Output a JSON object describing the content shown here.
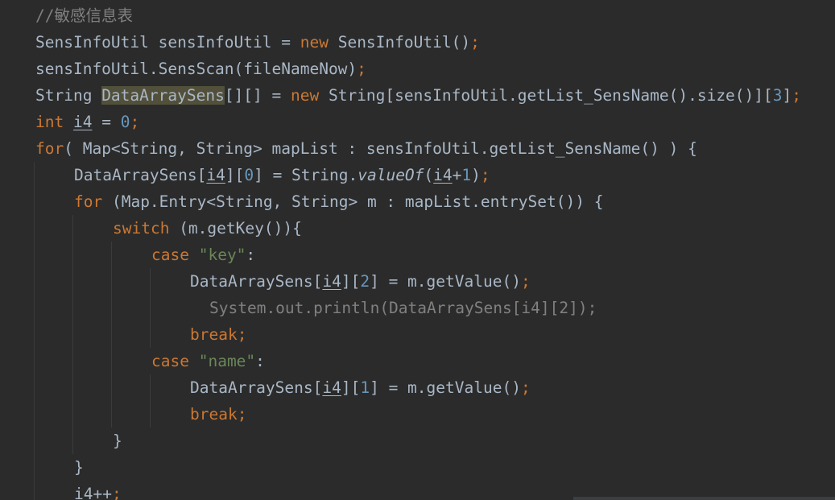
{
  "editor": {
    "language": "java",
    "colors": {
      "background": "#2b2b2b",
      "default_text": "#a9b7c6",
      "keyword": "#cc7832",
      "number": "#6897bb",
      "string": "#6a8759",
      "comment": "#808080",
      "highlight": "#52503a"
    },
    "lines": [
      {
        "indent": 0,
        "tokens": [
          {
            "t": "//敏感信息表",
            "c": "cmt"
          }
        ]
      },
      {
        "indent": 0,
        "tokens": [
          {
            "t": "SensInfoUtil sensInfoUtil = "
          },
          {
            "t": "new",
            "c": "kw"
          },
          {
            "t": " SensInfoUtil()"
          },
          {
            "t": ";",
            "c": "kw"
          }
        ]
      },
      {
        "indent": 0,
        "tokens": [
          {
            "t": "sensInfoUtil.SensScan(fileNameNow)"
          },
          {
            "t": ";",
            "c": "kw"
          }
        ]
      },
      {
        "indent": 0,
        "tokens": [
          {
            "t": "String "
          },
          {
            "t": "DataArraySens",
            "c": "hl"
          },
          {
            "t": "[][] = "
          },
          {
            "t": "new",
            "c": "kw"
          },
          {
            "t": " String[sensInfoUtil.getList_SensName().size()]["
          },
          {
            "t": "3",
            "c": "num"
          },
          {
            "t": "]"
          },
          {
            "t": ";",
            "c": "kw"
          }
        ]
      },
      {
        "indent": 0,
        "tokens": [
          {
            "t": "int",
            "c": "kw"
          },
          {
            "t": " "
          },
          {
            "t": "i4",
            "c": "var"
          },
          {
            "t": " = "
          },
          {
            "t": "0",
            "c": "num"
          },
          {
            "t": ";",
            "c": "kw"
          }
        ]
      },
      {
        "indent": 0,
        "tokens": [
          {
            "t": "for",
            "c": "kw"
          },
          {
            "t": "( Map<String, String> mapList : sensInfoUtil.getList_SensName() ) {"
          }
        ]
      },
      {
        "indent": 1,
        "tokens": [
          {
            "t": "DataArraySens["
          },
          {
            "t": "i4",
            "c": "var"
          },
          {
            "t": "]["
          },
          {
            "t": "0",
            "c": "num"
          },
          {
            "t": "] = String."
          },
          {
            "t": "valueOf",
            "c": "it"
          },
          {
            "t": "("
          },
          {
            "t": "i4",
            "c": "var"
          },
          {
            "t": "+"
          },
          {
            "t": "1",
            "c": "num"
          },
          {
            "t": ")"
          },
          {
            "t": ";",
            "c": "kw"
          }
        ]
      },
      {
        "indent": 1,
        "tokens": [
          {
            "t": "for",
            "c": "kw"
          },
          {
            "t": " (Map.Entry<String, String> m : mapList.entrySet()) {"
          }
        ]
      },
      {
        "indent": 2,
        "tokens": [
          {
            "t": "switch",
            "c": "kw"
          },
          {
            "t": " (m.getKey()){"
          }
        ]
      },
      {
        "indent": 3,
        "tokens": [
          {
            "t": "case",
            "c": "kw"
          },
          {
            "t": " "
          },
          {
            "t": "\"key\"",
            "c": "str"
          },
          {
            "t": ":"
          }
        ]
      },
      {
        "indent": 4,
        "tokens": [
          {
            "t": "DataArraySens["
          },
          {
            "t": "i4",
            "c": "var"
          },
          {
            "t": "]["
          },
          {
            "t": "2",
            "c": "num"
          },
          {
            "t": "] = m.getValue()"
          },
          {
            "t": ";",
            "c": "kw"
          }
        ]
      },
      {
        "indent": 4.5,
        "tokens": [
          {
            "t": "System.out.println(DataArraySens[i4][2]);",
            "c": "cmt"
          }
        ]
      },
      {
        "indent": 4,
        "tokens": [
          {
            "t": "break;",
            "c": "kw"
          }
        ]
      },
      {
        "indent": 3,
        "tokens": [
          {
            "t": "case",
            "c": "kw"
          },
          {
            "t": " "
          },
          {
            "t": "\"name\"",
            "c": "str"
          },
          {
            "t": ":"
          }
        ]
      },
      {
        "indent": 4,
        "tokens": [
          {
            "t": "DataArraySens["
          },
          {
            "t": "i4",
            "c": "var"
          },
          {
            "t": "]["
          },
          {
            "t": "1",
            "c": "num"
          },
          {
            "t": "] = m.getValue()"
          },
          {
            "t": ";",
            "c": "kw"
          }
        ]
      },
      {
        "indent": 4,
        "tokens": [
          {
            "t": "break;",
            "c": "kw"
          }
        ]
      },
      {
        "indent": 2,
        "tokens": [
          {
            "t": "}"
          }
        ]
      },
      {
        "indent": 1,
        "tokens": [
          {
            "t": "}"
          }
        ]
      },
      {
        "indent": 1,
        "tokens": [
          {
            "t": "i4",
            "c": "var"
          },
          {
            "t": "++"
          },
          {
            "t": ";",
            "c": "kw"
          }
        ]
      }
    ]
  }
}
